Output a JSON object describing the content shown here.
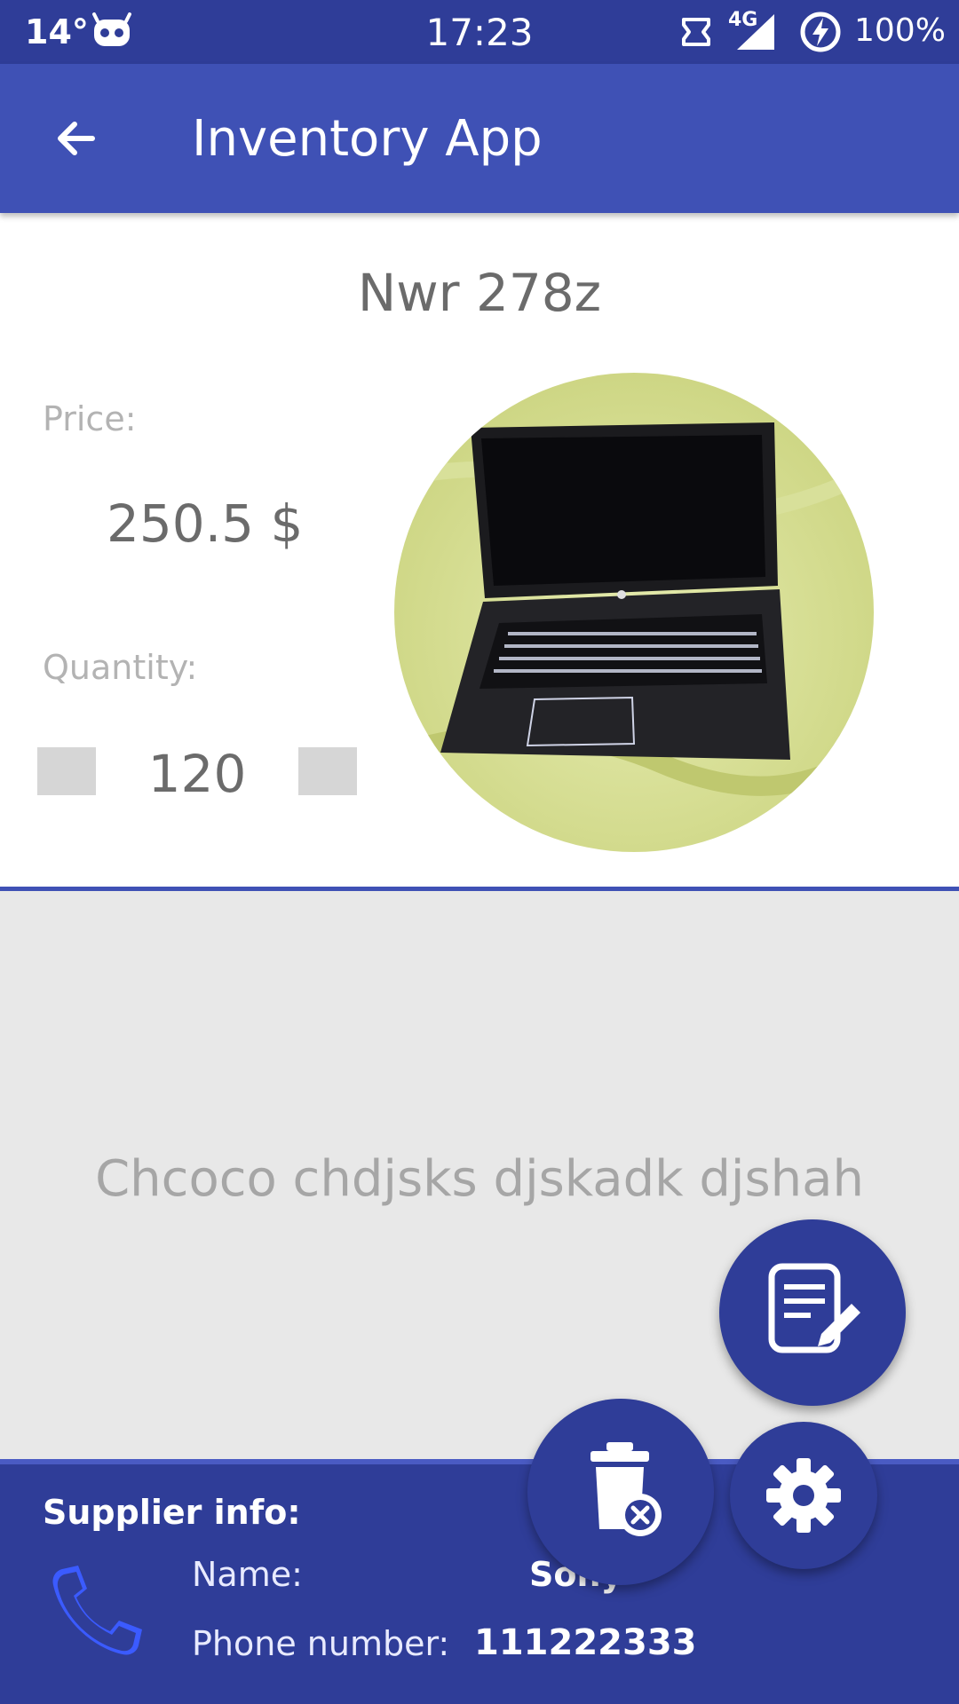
{
  "status_bar": {
    "temperature": "14°",
    "time": "17:23",
    "network": "4G",
    "battery": "100%"
  },
  "app_bar": {
    "title": "Inventory App"
  },
  "product": {
    "name": "Nwr 278z",
    "price_label": "Price:",
    "price_value": "250.5 $",
    "quantity_label": "Quantity:",
    "quantity_value": "120",
    "description": "Chcoco chdjsks djskadk djshah"
  },
  "supplier": {
    "title": "Supplier info:",
    "name_label": "Name:",
    "name_value": "Sony",
    "phone_label": "Phone number:",
    "phone_value": "111222333"
  },
  "colors": {
    "primary": "#3f51b5",
    "primary_dark": "#2f3d98",
    "description_bg": "#e8e8e8"
  },
  "icons": {
    "back": "arrow-back-icon",
    "edit": "edit-note-icon",
    "delete": "delete-icon",
    "settings": "gear-icon",
    "phone": "phone-icon"
  }
}
